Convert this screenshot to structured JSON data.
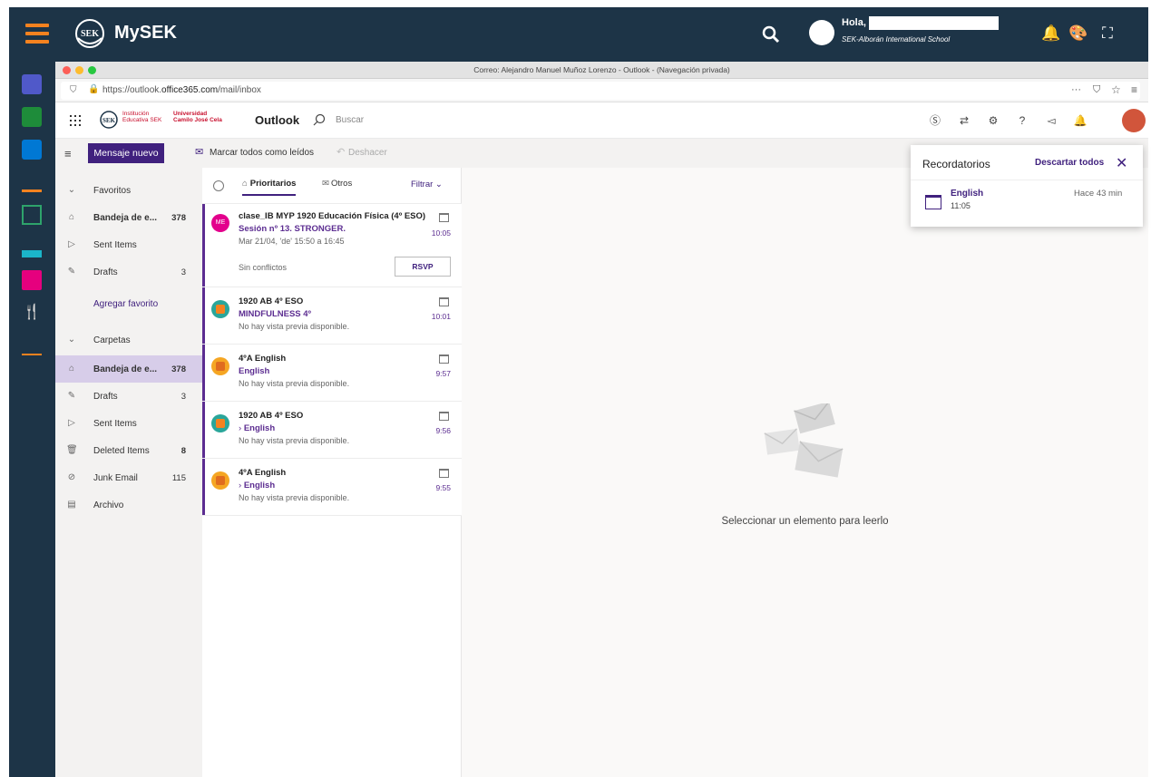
{
  "colors": {
    "mysek_bar": "#1d3447",
    "accent_orange": "#f5821f",
    "outlook_purple": "#40217e",
    "selected_folder": "#d7cde9"
  },
  "mysek": {
    "title": "MySEK",
    "greeting": "Hola,",
    "school": "SEK-Alborán International School"
  },
  "browser": {
    "window_title": "Correo: Alejandro Manuel Muñoz Lorenzo - Outlook - (Navegación privada)",
    "url_prefix": "https://outlook.",
    "url_host": "office365.com",
    "url_suffix": "/mail/inbox"
  },
  "outlook": {
    "brand_line1": "Institución",
    "brand_line2": "Educativa SEK",
    "brand_univ1": "Universidad",
    "brand_univ2": "Camilo José Cela",
    "title": "Outlook",
    "search_placeholder": "Buscar"
  },
  "commands": {
    "new_message": "Mensaje nuevo",
    "mark_all_read": "Marcar todos como leídos",
    "undo": "Deshacer"
  },
  "folders": {
    "favorites_header": "Favoritos",
    "favorites": [
      {
        "label": "Bandeja de e...",
        "count": "378",
        "icon": "inbox-icon"
      },
      {
        "label": "Sent Items",
        "count": "",
        "icon": "send-icon"
      },
      {
        "label": "Drafts",
        "count": "3",
        "icon": "pencil-icon"
      }
    ],
    "add_favorite": "Agregar favorito",
    "folders_header": "Carpetas",
    "folders": [
      {
        "label": "Bandeja de e...",
        "count": "378",
        "icon": "inbox-icon"
      },
      {
        "label": "Drafts",
        "count": "3",
        "icon": "pencil-icon"
      },
      {
        "label": "Sent Items",
        "count": "",
        "icon": "send-icon"
      },
      {
        "label": "Deleted Items",
        "count": "8",
        "icon": "trash-icon"
      },
      {
        "label": "Junk Email",
        "count": "115",
        "icon": "block-icon"
      },
      {
        "label": "Archivo",
        "count": "",
        "icon": "archive-icon"
      }
    ]
  },
  "list": {
    "tab_focused": "Prioritarios",
    "tab_other": "Otros",
    "filter": "Filtrar",
    "messages": [
      {
        "initials": "ME",
        "from": "clase_IB MYP 1920 Educación Física (4º ESO)",
        "subject": "Sesión nº 13. STRONGER.",
        "preview": "Mar 21/04, 'de' 15:50 a 16:45",
        "time": "10:05",
        "conflict": "Sin conflictos",
        "rsvp": "RSVP"
      },
      {
        "from": "1920 AB 4º ESO",
        "subject": "MINDFULNESS 4º",
        "preview": "No hay vista previa disponible.",
        "time": "10:01"
      },
      {
        "from": "4ºA English",
        "subject": "English",
        "preview": "No hay vista previa disponible.",
        "time": "9:57"
      },
      {
        "from": "1920 AB 4º ESO",
        "subject": "English",
        "preview": "No hay vista previa disponible.",
        "time": "9:56"
      },
      {
        "from": "4ºA English",
        "subject": "English",
        "preview": "No hay vista previa disponible.",
        "time": "9:55"
      }
    ]
  },
  "reading_pane": {
    "empty_text": "Seleccionar un elemento para leerlo"
  },
  "reminders": {
    "title": "Recordatorios",
    "dismiss_all": "Descartar todos",
    "items": [
      {
        "name": "English",
        "time": "11:05",
        "ago": "Hace 43 min"
      }
    ]
  }
}
